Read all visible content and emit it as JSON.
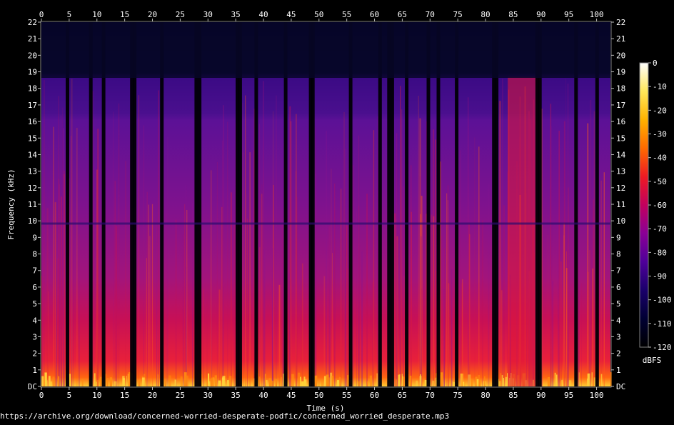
{
  "chart_data": {
    "type": "heatmap",
    "subtype": "spectrogram",
    "title": "",
    "xlabel": "Time (s)",
    "ylabel": "Frequency (kHz)",
    "xlim": [
      0,
      102.5
    ],
    "ylim": [
      0,
      22
    ],
    "x_ticks": [
      0,
      5,
      10,
      15,
      20,
      25,
      30,
      35,
      40,
      45,
      50,
      55,
      60,
      65,
      70,
      75,
      80,
      85,
      90,
      95,
      100
    ],
    "y_tick_labels": [
      "DC",
      "1",
      "2",
      "3",
      "4",
      "5",
      "6",
      "7",
      "8",
      "9",
      "10",
      "11",
      "12",
      "13",
      "14",
      "15",
      "16",
      "17",
      "18",
      "19",
      "20",
      "21",
      "22"
    ],
    "colorbar": {
      "label": "dBFS",
      "range": [
        -120,
        0
      ],
      "tick_labels": [
        "0",
        "-10",
        "-20",
        "-30",
        "-40",
        "-50",
        "-60",
        "-70",
        "-80",
        "-90",
        "-100",
        "-110",
        "-120"
      ],
      "colors": [
        "#000000",
        "#000033",
        "#1a006b",
        "#4f009a",
        "#8a0096",
        "#c2005e",
        "#ee1a23",
        "#ff6a00",
        "#ffb200",
        "#ffe85a",
        "#ffffff"
      ]
    },
    "silence_gaps_s": [
      4.7,
      8.9,
      11.2,
      16.3,
      16.8,
      21.7,
      27.9,
      28.5,
      35.3,
      35.8,
      38.7,
      44.0,
      48.5,
      48.9,
      55.7,
      61.0,
      62.6,
      63.2,
      65.8,
      69.7,
      71.5,
      74.8,
      81.5,
      82.0,
      89.3,
      89.8,
      96.3,
      100.1
    ],
    "loud_region_s": [
      84,
      90
    ],
    "cutoff_khz": 18.6,
    "secondary_band_khz": 16
  },
  "footer": {
    "source": "https://archive.org/download/concerned-worried-desperate-podfic/concerned_worried_desperate.mp3"
  }
}
